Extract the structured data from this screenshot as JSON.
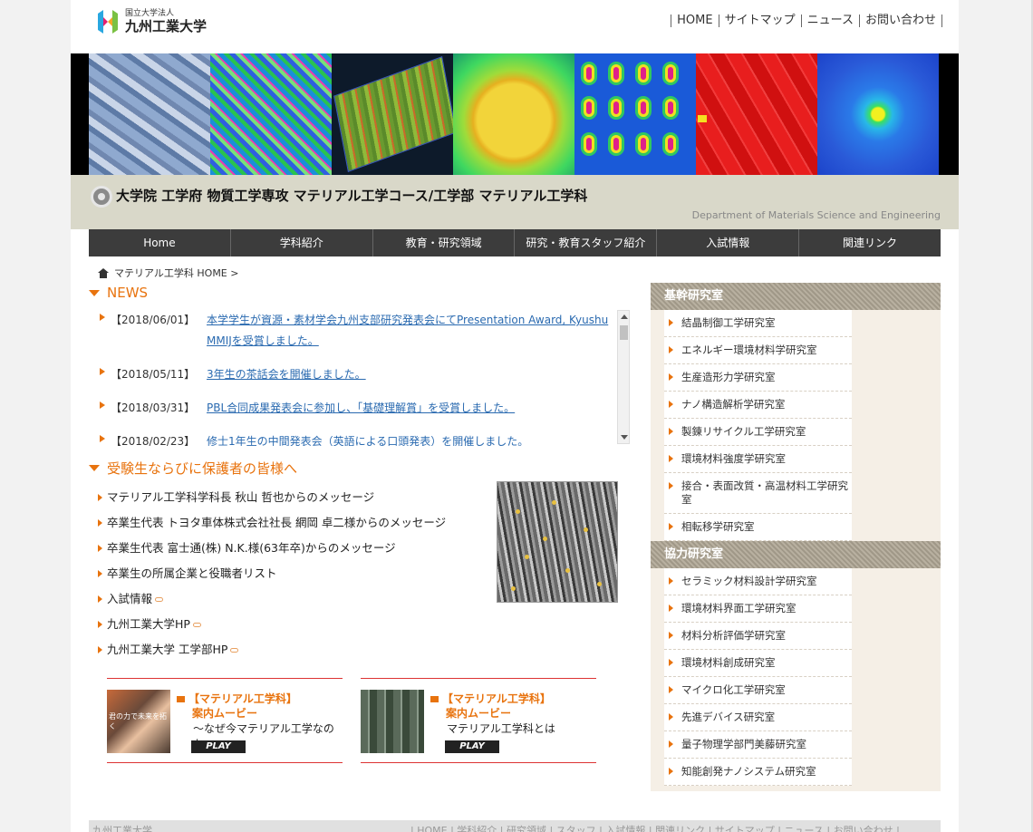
{
  "header": {
    "logo_line1": "国立大学法人",
    "logo_line2": "九州工業大学",
    "links": [
      "HOME",
      "サイトマップ",
      "ニュース",
      "お問い合わせ"
    ]
  },
  "title": {
    "main": "大学院 工学府 物質工学専攻 マテリアル工学コース/工学部 マテリアル工学科",
    "sub": "Department of Materials Science and Engineering"
  },
  "nav": [
    "Home",
    "学科紹介",
    "教育・研究領域",
    "研究・教育スタッフ紹介",
    "入試情報",
    "関連リンク"
  ],
  "breadcrumb": "マテリアル工学科 HOME >",
  "news": {
    "heading": "NEWS",
    "items": [
      {
        "date": "【2018/06/01】",
        "text": "本学学生が資源・素材学会九州支部研究発表会にてPresentation Award, Kyushu MMIJを受賞しました。"
      },
      {
        "date": "【2018/05/11】",
        "text": "3年生の茶話会を開催しました。"
      },
      {
        "date": "【2018/03/31】",
        "text": "PBL合同成果発表会に参加し、「基礎理解賞」を受賞しました。"
      },
      {
        "date": "【2018/02/23】",
        "text": "修士1年生の中間発表会（英語による口頭発表）を開催しました。"
      }
    ]
  },
  "candidates": {
    "heading": "受験生ならびに保護者の皆様へ",
    "items": [
      {
        "label": "マテリアル工学科学科長 秋山 哲也からのメッセージ",
        "external": false
      },
      {
        "label": "卒業生代表 トヨタ車体株式会社社長 網岡 卓二様からのメッセージ",
        "external": false
      },
      {
        "label": "卒業生代表 富士通(株) N.K.様(63年卒)からのメッセージ",
        "external": false
      },
      {
        "label": "卒業生の所属企業と役職者リスト",
        "external": false
      },
      {
        "label": "入試情報",
        "external": true
      },
      {
        "label": "九州工業大学HP",
        "external": true
      },
      {
        "label": "九州工業大学 工学部HP",
        "external": true
      }
    ]
  },
  "videos": [
    {
      "title1": "【マテリアル工学科】",
      "title2": "案内ムービー",
      "sub": "～なぜ今マテリアル工学なのか～",
      "play": "PLAY",
      "thumb_caption": "君の力で未来を拓く"
    },
    {
      "title1": "【マテリアル工学科】",
      "title2": "案内ムービー",
      "sub": "マテリアル工学科とは",
      "play": "PLAY",
      "thumb_caption": ""
    }
  ],
  "sidebar": {
    "core_heading": "基幹研究室",
    "core": [
      "結晶制御工学研究室",
      "エネルギー環境材料学研究室",
      "生産造形力学研究室",
      "ナノ構造解析学研究室",
      "製錬リサイクル工学研究室",
      "環境材料強度学研究室",
      "接合・表面改質・高温材料工学研究室",
      "相転移学研究室"
    ],
    "coop_heading": "協力研究室",
    "coop": [
      "セラミック材料設計学研究室",
      "環境材料界面工学研究室",
      "材料分析評価学研究室",
      "環境材料創成研究室",
      "マイクロ化工学研究室",
      "先進デバイス研究室",
      "量子物理学部門美藤研究室",
      "知能創発ナノシステム研究室"
    ]
  },
  "footer": {
    "left": "九州工業大学",
    "right": "| HOME | 学科紹介 | 研究領域 | スタッフ | 入試情報 | 関連リンク | サイトマップ | ニュース | お問い合わせ |"
  },
  "colors": {
    "accent": "#e8730e",
    "nav_bg": "#3c3c3c",
    "title_bg": "#d9d8c9",
    "link": "#2a6ab0"
  }
}
